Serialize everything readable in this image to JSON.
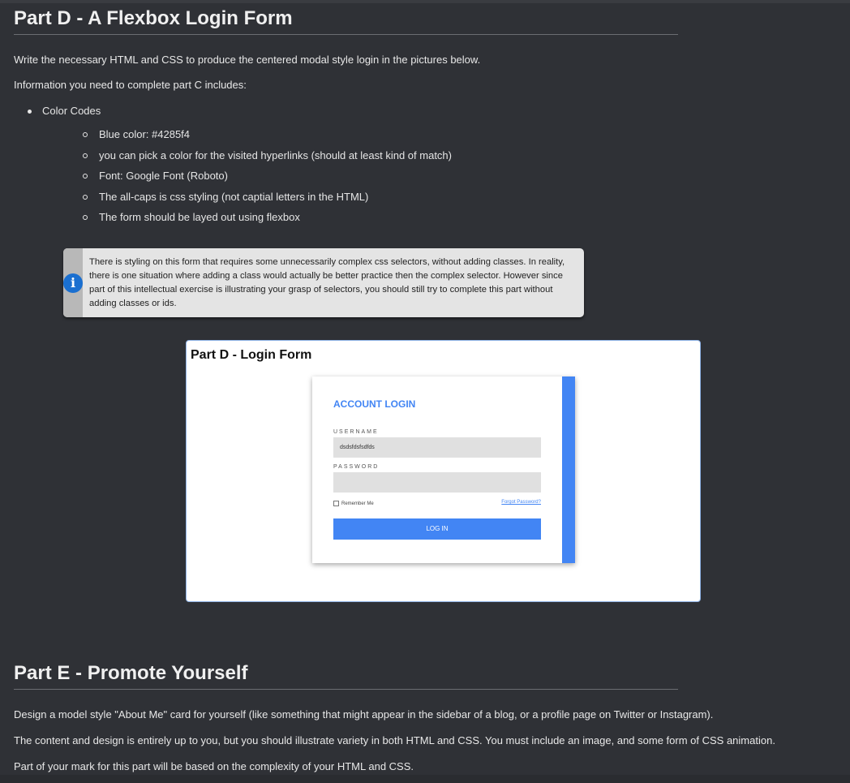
{
  "part_d": {
    "heading": "Part D - A Flexbox Login Form",
    "intro": "Write the necessary HTML and CSS to produce the centered modal style login in the pictures below.",
    "info_lead": "Information you need to complete part C includes:",
    "list": {
      "title": "Color Codes",
      "items": [
        "Blue color: #4285f4",
        "you can pick a color for the visited hyperlinks (should at least kind of match)",
        "Font: Google Font (Roboto)",
        "The all-caps is css styling (not captial letters in the HTML)",
        "The form should be layed out using flexbox"
      ]
    },
    "note": {
      "icon": "info-icon",
      "text": "There is styling on this form that requires some unnecessarily complex css selectors, without adding classes. In reality, there is one situation where adding a class would actually be better practice then the complex selector. However since part of this intellectual exercise is illustrating your grasp of selectors, you should still try to complete this part without adding classes or ids."
    },
    "screenshot": {
      "title": "Part D - Login Form",
      "card_title": "Account Login",
      "username_label": "Username",
      "username_value": "dsdsfdsfsdfds",
      "password_label": "Password",
      "password_value": "",
      "remember_label": "Remember Me",
      "forgot_link": "Forgot Password?",
      "login_button": "Log In",
      "accent_color": "#4285f4"
    }
  },
  "part_e": {
    "heading": "Part E - Promote Yourself",
    "p1": "Design a model style \"About Me\" card for yourself (like something that might appear in the sidebar of a blog, or a profile page on Twitter or Instagram).",
    "p2": "The content and design is entirely up to you, but you should illustrate variety in both HTML and CSS. You must include an image, and some form of CSS animation.",
    "p3": "Part of your mark for this part will be based on the complexity of your HTML and CSS."
  }
}
